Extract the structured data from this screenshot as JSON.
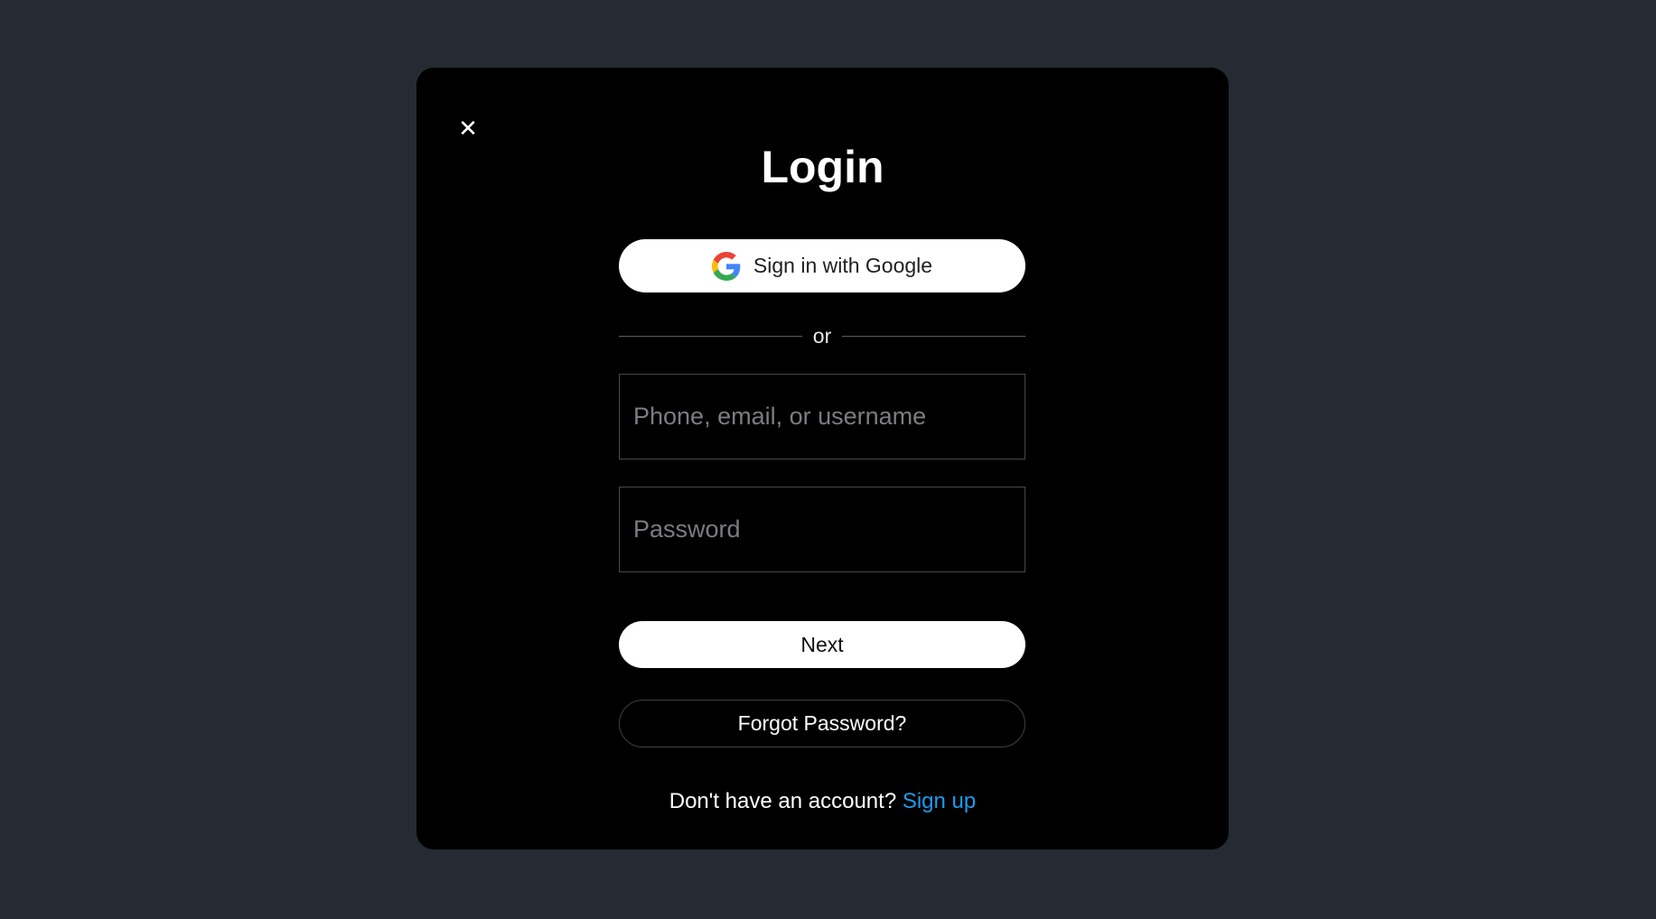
{
  "modal": {
    "close_symbol": "✕",
    "title": "Login"
  },
  "google_button": {
    "label": "Sign in with Google",
    "icon": "google-icon"
  },
  "divider": {
    "label": "or"
  },
  "fields": {
    "identifier_placeholder": "Phone, email, or username",
    "password_placeholder": "Password"
  },
  "buttons": {
    "next_label": "Next",
    "forgot_label": "Forgot Password?"
  },
  "signup": {
    "prompt": "Don't have an account?",
    "link_label": "Sign up"
  },
  "colors": {
    "page_background": "#242b33",
    "modal_background": "#000000",
    "link": "#1d9bf0"
  }
}
